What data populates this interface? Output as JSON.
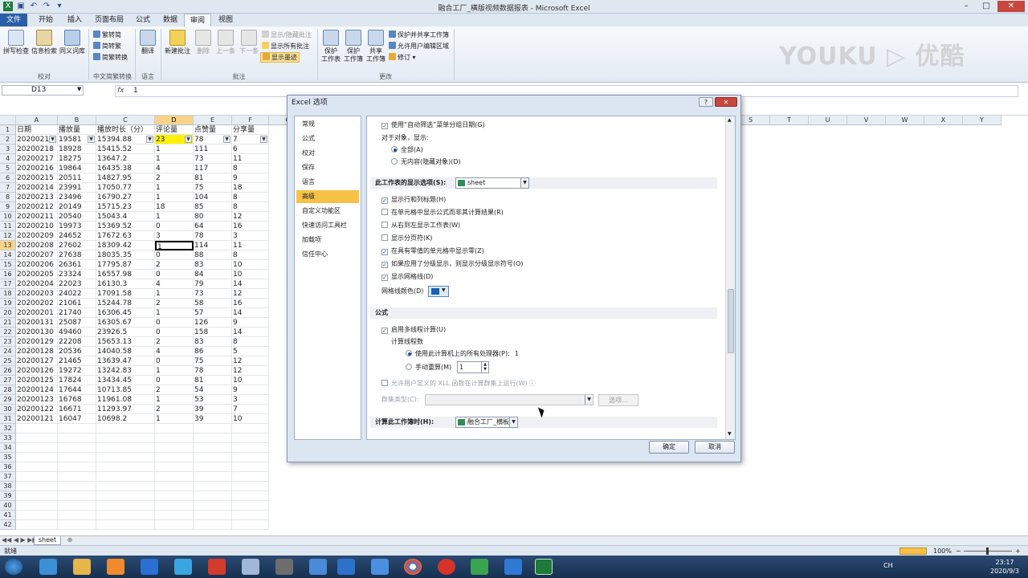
{
  "window": {
    "title": "融合工厂_横版视频数据报表 - Microsoft Excel",
    "minimize": "–",
    "maximize": "□",
    "close": "✕"
  },
  "tabs": [
    "文件",
    "开始",
    "插入",
    "页面布局",
    "公式",
    "数据",
    "审阅",
    "视图"
  ],
  "active_tab": "审阅",
  "ribbon": {
    "groups": {
      "proofing": "校对",
      "chinese": "中文简繁转换",
      "language": "语言",
      "comments": "批注",
      "changes": "更改"
    },
    "buttons": {
      "spell": "拼写检查",
      "research": "信息检索",
      "thesaurus": "同义词库",
      "to_trad": "繁转简",
      "to_simp": "简转繁",
      "convert": "简繁转换",
      "translate": "翻译",
      "new_comment": "新建批注",
      "delete": "删除",
      "prev": "上一条",
      "next": "下一条",
      "show_hide": "显示/隐藏批注",
      "show_all": "显示所有批注",
      "show_ink": "显示墨迹",
      "protect_sheet": "保护\n工作表",
      "protect_book": "保护\n工作簿",
      "share_book": "共享\n工作簿",
      "protect_share": "保护并共享工作簿",
      "allow_edit": "允许用户编辑区域",
      "track": "修订 ▾"
    },
    "watermark": "YOUKU ▷ 优酷"
  },
  "formula_bar": {
    "name_box": "D13",
    "fx": "fx",
    "value": "1"
  },
  "columns": [
    "A",
    "B",
    "C",
    "D",
    "E",
    "F",
    "G",
    "H",
    "I",
    "J",
    "K",
    "L",
    "M",
    "N",
    "O",
    "P",
    "Q",
    "R",
    "S",
    "T",
    "U",
    "V",
    "W",
    "X",
    "Y"
  ],
  "selected_col": "D",
  "headers": [
    "日期",
    "播放量",
    "播放时长（分）",
    "评论量",
    "点赞量",
    "分享量"
  ],
  "rows": [
    [
      "2020021",
      "19581",
      "15394.88",
      "23",
      "78",
      "7"
    ],
    [
      "20200218",
      "18928",
      "15415.52",
      "1",
      "111",
      "6"
    ],
    [
      "20200217",
      "18275",
      "13647.2",
      "1",
      "73",
      "11"
    ],
    [
      "20200216",
      "19864",
      "16435.38",
      "4",
      "117",
      "8"
    ],
    [
      "20200215",
      "20511",
      "14827.95",
      "2",
      "81",
      "9"
    ],
    [
      "20200214",
      "23991",
      "17050.77",
      "1",
      "75",
      "18"
    ],
    [
      "20200213",
      "23496",
      "16790.27",
      "1",
      "104",
      "8"
    ],
    [
      "20200212",
      "20149",
      "15715.23",
      "18",
      "85",
      "8"
    ],
    [
      "20200211",
      "20540",
      "15043.4",
      "1",
      "80",
      "12"
    ],
    [
      "20200210",
      "19973",
      "15369.52",
      "0",
      "64",
      "16"
    ],
    [
      "20200209",
      "24652",
      "17672.63",
      "3",
      "78",
      "3"
    ],
    [
      "20200208",
      "27602",
      "18309.42",
      "1",
      "114",
      "11"
    ],
    [
      "20200207",
      "27638",
      "18035.35",
      "0",
      "88",
      "8"
    ],
    [
      "20200206",
      "26361",
      "17795.87",
      "2",
      "83",
      "10"
    ],
    [
      "20200205",
      "23324",
      "16557.98",
      "0",
      "84",
      "10"
    ],
    [
      "20200204",
      "22023",
      "16130.3",
      "4",
      "79",
      "14"
    ],
    [
      "20200203",
      "24022",
      "17091.58",
      "1",
      "73",
      "12"
    ],
    [
      "20200202",
      "21061",
      "15244.78",
      "2",
      "58",
      "16"
    ],
    [
      "20200201",
      "21740",
      "16306.45",
      "1",
      "57",
      "14"
    ],
    [
      "20200131",
      "25087",
      "16305.67",
      "0",
      "126",
      "9"
    ],
    [
      "20200130",
      "49460",
      "23926.5",
      "0",
      "158",
      "14"
    ],
    [
      "20200129",
      "22208",
      "15653.13",
      "2",
      "83",
      "8"
    ],
    [
      "20200128",
      "20536",
      "14040.58",
      "4",
      "86",
      "5"
    ],
    [
      "20200127",
      "21465",
      "13639.47",
      "0",
      "75",
      "12"
    ],
    [
      "20200126",
      "19272",
      "13242.83",
      "1",
      "78",
      "12"
    ],
    [
      "20200125",
      "17824",
      "13434.45",
      "0",
      "81",
      "10"
    ],
    [
      "20200124",
      "17644",
      "10713.85",
      "2",
      "54",
      "9"
    ],
    [
      "20200123",
      "16768",
      "11961.08",
      "1",
      "53",
      "3"
    ],
    [
      "20200122",
      "16671",
      "11293.97",
      "2",
      "39",
      "7"
    ],
    [
      "20200121",
      "16047",
      "10698.2",
      "1",
      "39",
      "10"
    ]
  ],
  "row_numbers": [
    "1",
    "2",
    "3",
    "4",
    "5",
    "6",
    "7",
    "8",
    "9",
    "10",
    "11",
    "12",
    "13",
    "14",
    "15",
    "16",
    "17",
    "18",
    "19",
    "20",
    "21",
    "22",
    "23",
    "24",
    "25",
    "26",
    "27",
    "28",
    "29",
    "30",
    "31",
    "32",
    "33",
    "34",
    "35",
    "36",
    "37",
    "38",
    "39",
    "40",
    "41",
    "42"
  ],
  "sheet_tab": "sheet",
  "status": {
    "ready": "就绪",
    "zoom": "100%",
    "minus": "−",
    "plus": "+"
  },
  "taskbar": {
    "time": "23:17",
    "date": "2020/9/3",
    "lang": "CH"
  },
  "dialog": {
    "title": "Excel 选项",
    "help": "?",
    "close": "✕",
    "nav": [
      "常规",
      "公式",
      "校对",
      "保存",
      "语言",
      "高级",
      "自定义功能区",
      "快速访问工具栏",
      "加载项",
      "信任中心"
    ],
    "nav_selected": "高级",
    "options": {
      "autofilter_group": "使用“自动筛选”菜单分组日期(G)",
      "for_objects": "对于对象，显示:",
      "all": "全部(A)",
      "nothing": "无内容(隐藏对象)(D)",
      "sheet_section": "此工作表的显示选项(S):",
      "sheet_combo": "sheet",
      "show_headers": "显示行和列标题(H)",
      "show_formulas": "在单元格中显示公式而非其计算结果(R)",
      "rtl": "从右到左显示工作表(W)",
      "page_breaks": "显示分页符(K)",
      "show_zero": "在具有零值的单元格中显示零(Z)",
      "outline": "如果应用了分级显示，则显示分级显示符号(O)",
      "gridlines": "显示网格线(D)",
      "grid_color": "网格线颜色(D)",
      "formula_section": "公式",
      "multithread": "启用多线程计算(U)",
      "threads": "计算线程数",
      "use_all": "使用此计算机上的所有处理器(P):",
      "use_all_n": "1",
      "manual": "手动重算(M)",
      "manual_n": "1",
      "xll": "允许用户定义的 XLL 函数在计算群集上运行(W)",
      "cluster": "群集类型(C):",
      "options_btn": "选项...",
      "calc_section": "计算此工作簿时(H):",
      "calc_combo": "融合工厂_横板..."
    },
    "ok": "确定",
    "cancel": "取消"
  }
}
